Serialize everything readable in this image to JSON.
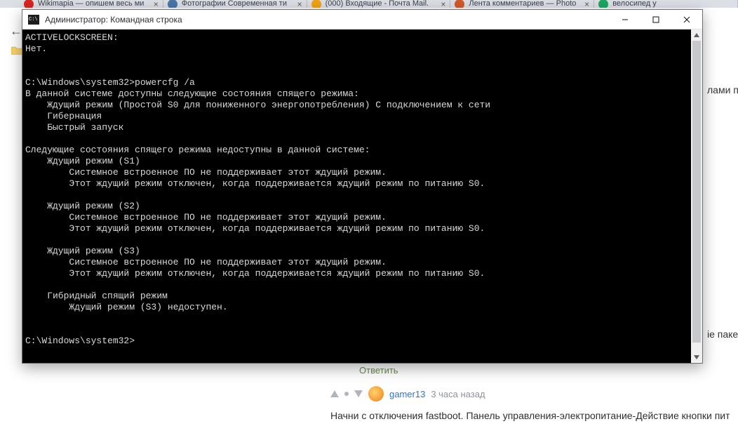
{
  "browser": {
    "tabs": [
      {
        "name": "tab-wikimapia",
        "favicon": "#d82620",
        "title": "Wikimapia — опишем весь ми"
      },
      {
        "name": "tab-vk",
        "favicon": "#4a76a8",
        "title": "Фотографии Современная ти"
      },
      {
        "name": "tab-mail",
        "favicon": "#f2a215",
        "title": "(000) Входящие - Почта Mail."
      },
      {
        "name": "tab-photo",
        "favicon": "#d3592a",
        "title": "Лента комментариев — Photo"
      },
      {
        "name": "tab-bike",
        "favicon": "#1aa861",
        "title": "велосипед у"
      }
    ]
  },
  "background": {
    "text_right_1": "лами пи",
    "text_right_2": "іе паке",
    "reply": "Ответить",
    "comment": {
      "username": "gamer13",
      "time": "3 часа назад",
      "body": "Начни с отключения fastboot. Панель управления-электропитание-Действие кнопки пит"
    }
  },
  "console": {
    "title": "Администратор: Командная строка",
    "lines": [
      "ACTIVELOCKSCREEN:",
      "Нет.",
      "",
      "",
      "C:\\Windows\\system32>powercfg /a",
      "В данной системе доступны следующие состояния спящего режима:",
      "    Ждущий режим (Простой S0 для пониженного энергопотребления) С подключением к сети",
      "    Гибернация",
      "    Быстрый запуск",
      "",
      "Следующие состояния спящего режима недоступны в данной системе:",
      "    Ждущий режим (S1)",
      "        Системное встроенное ПО не поддерживает этот ждущий режим.",
      "        Этот ждущий режим отключен, когда поддерживается ждущий режим по питанию S0.",
      "",
      "    Ждущий режим (S2)",
      "        Системное встроенное ПО не поддерживает этот ждущий режим.",
      "        Этот ждущий режим отключен, когда поддерживается ждущий режим по питанию S0.",
      "",
      "    Ждущий режим (S3)",
      "        Системное встроенное ПО не поддерживает этот ждущий режим.",
      "        Этот ждущий режим отключен, когда поддерживается ждущий режим по питанию S0.",
      "",
      "    Гибридный спящий режим",
      "        Ждущий режим (S3) недоступен.",
      "",
      "",
      "C:\\Windows\\system32>"
    ]
  },
  "icons": {
    "close_x": "×",
    "back": "←"
  }
}
